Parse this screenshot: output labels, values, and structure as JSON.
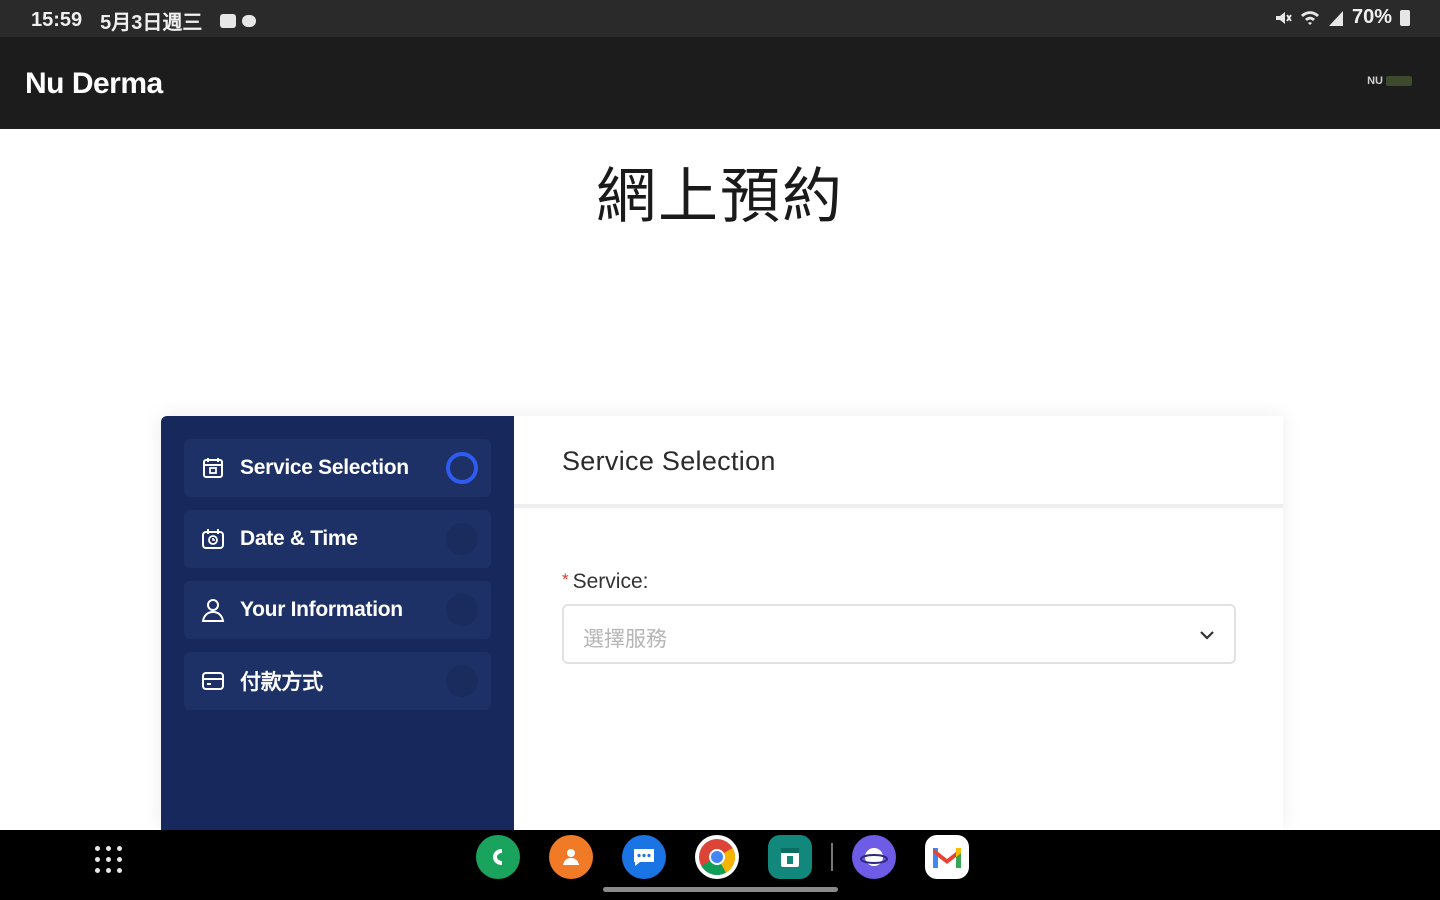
{
  "status_bar": {
    "time": "15:59",
    "date": "5月3日週三",
    "battery": "70%"
  },
  "app_bar": {
    "title": "Nu Derma",
    "logo_text": "NU"
  },
  "page": {
    "heading": "網上預約"
  },
  "steps": [
    {
      "label": "Service Selection",
      "icon": "calendar-check-icon",
      "active": true
    },
    {
      "label": "Date & Time",
      "icon": "calendar-clock-icon",
      "active": false
    },
    {
      "label": "Your Information",
      "icon": "user-icon",
      "active": false
    },
    {
      "label": "付款方式",
      "icon": "credit-card-icon",
      "active": false
    }
  ],
  "content": {
    "title": "Service Selection",
    "service_field": {
      "required_mark": "*",
      "label": "Service:",
      "placeholder": "選擇服務"
    }
  },
  "dock": {
    "apps": [
      {
        "name": "phone",
        "color": "#1aa35c"
      },
      {
        "name": "contacts",
        "color": "#f07a25"
      },
      {
        "name": "messages",
        "color": "#1b74e4"
      },
      {
        "name": "chrome",
        "color": "#ffffff"
      },
      {
        "name": "calendar",
        "color": "#12887c"
      },
      {
        "name": "internet",
        "color": "#6e5ce6"
      },
      {
        "name": "gmail",
        "color": "#ffffff"
      }
    ]
  },
  "colors": {
    "steps_panel": "#17285d",
    "active_indicator": "#2f5bf0",
    "app_bar": "#1c1c1c",
    "required": "#e0392b"
  }
}
